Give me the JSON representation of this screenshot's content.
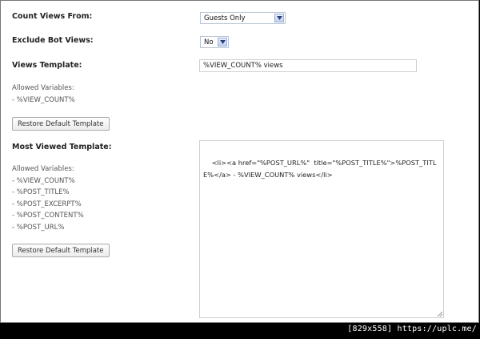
{
  "count_views": {
    "label": "Count Views From:",
    "selected": "Guests Only"
  },
  "exclude_bots": {
    "label": "Exclude Bot Views:",
    "selected": "No"
  },
  "views_template": {
    "label": "Views Template:",
    "value": "%VIEW_COUNT% views",
    "allowed_title": "Allowed Variables:",
    "allowed": [
      "- %VIEW_COUNT%"
    ],
    "restore_label": "Restore Default Template"
  },
  "most_viewed": {
    "label": "Most Viewed Template:",
    "value": "<li><a href=\"%POST_URL%\"  title=\"%POST_TITLE%\">%POST_TITLE%</a> - %VIEW_COUNT% views</li>",
    "allowed_title": "Allowed Variables:",
    "allowed": [
      "- %VIEW_COUNT%",
      "- %POST_TITLE%",
      "- %POST_EXCERPT%",
      "- %POST_CONTENT%",
      "- %POST_URL%"
    ],
    "restore_label": "Restore Default Template"
  },
  "watermark": "[829x558] https://uplc.me/"
}
